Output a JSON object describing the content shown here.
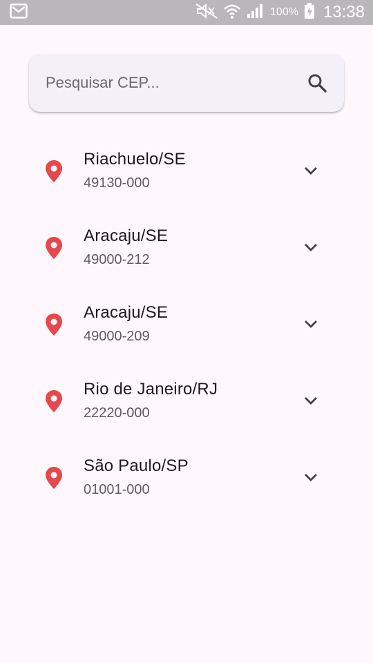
{
  "status_bar": {
    "battery_text": "100%",
    "time": "13:38",
    "icons": [
      "gmail-icon",
      "mute-icon",
      "wifi-icon",
      "signal-icon",
      "battery-charging-icon"
    ]
  },
  "search": {
    "placeholder": "Pesquisar CEP...",
    "value": "",
    "icon": "search-icon"
  },
  "colors": {
    "background": "#fef7fb",
    "pin": "#e5484d",
    "search_bg": "#f4f0fa"
  },
  "results": [
    {
      "city": "Riachuelo/SE",
      "cep": "49130-000"
    },
    {
      "city": "Aracaju/SE",
      "cep": "49000-212"
    },
    {
      "city": "Aracaju/SE",
      "cep": "49000-209"
    },
    {
      "city": "Rio de Janeiro/RJ",
      "cep": "22220-000"
    },
    {
      "city": "São Paulo/SP",
      "cep": "01001-000"
    }
  ]
}
